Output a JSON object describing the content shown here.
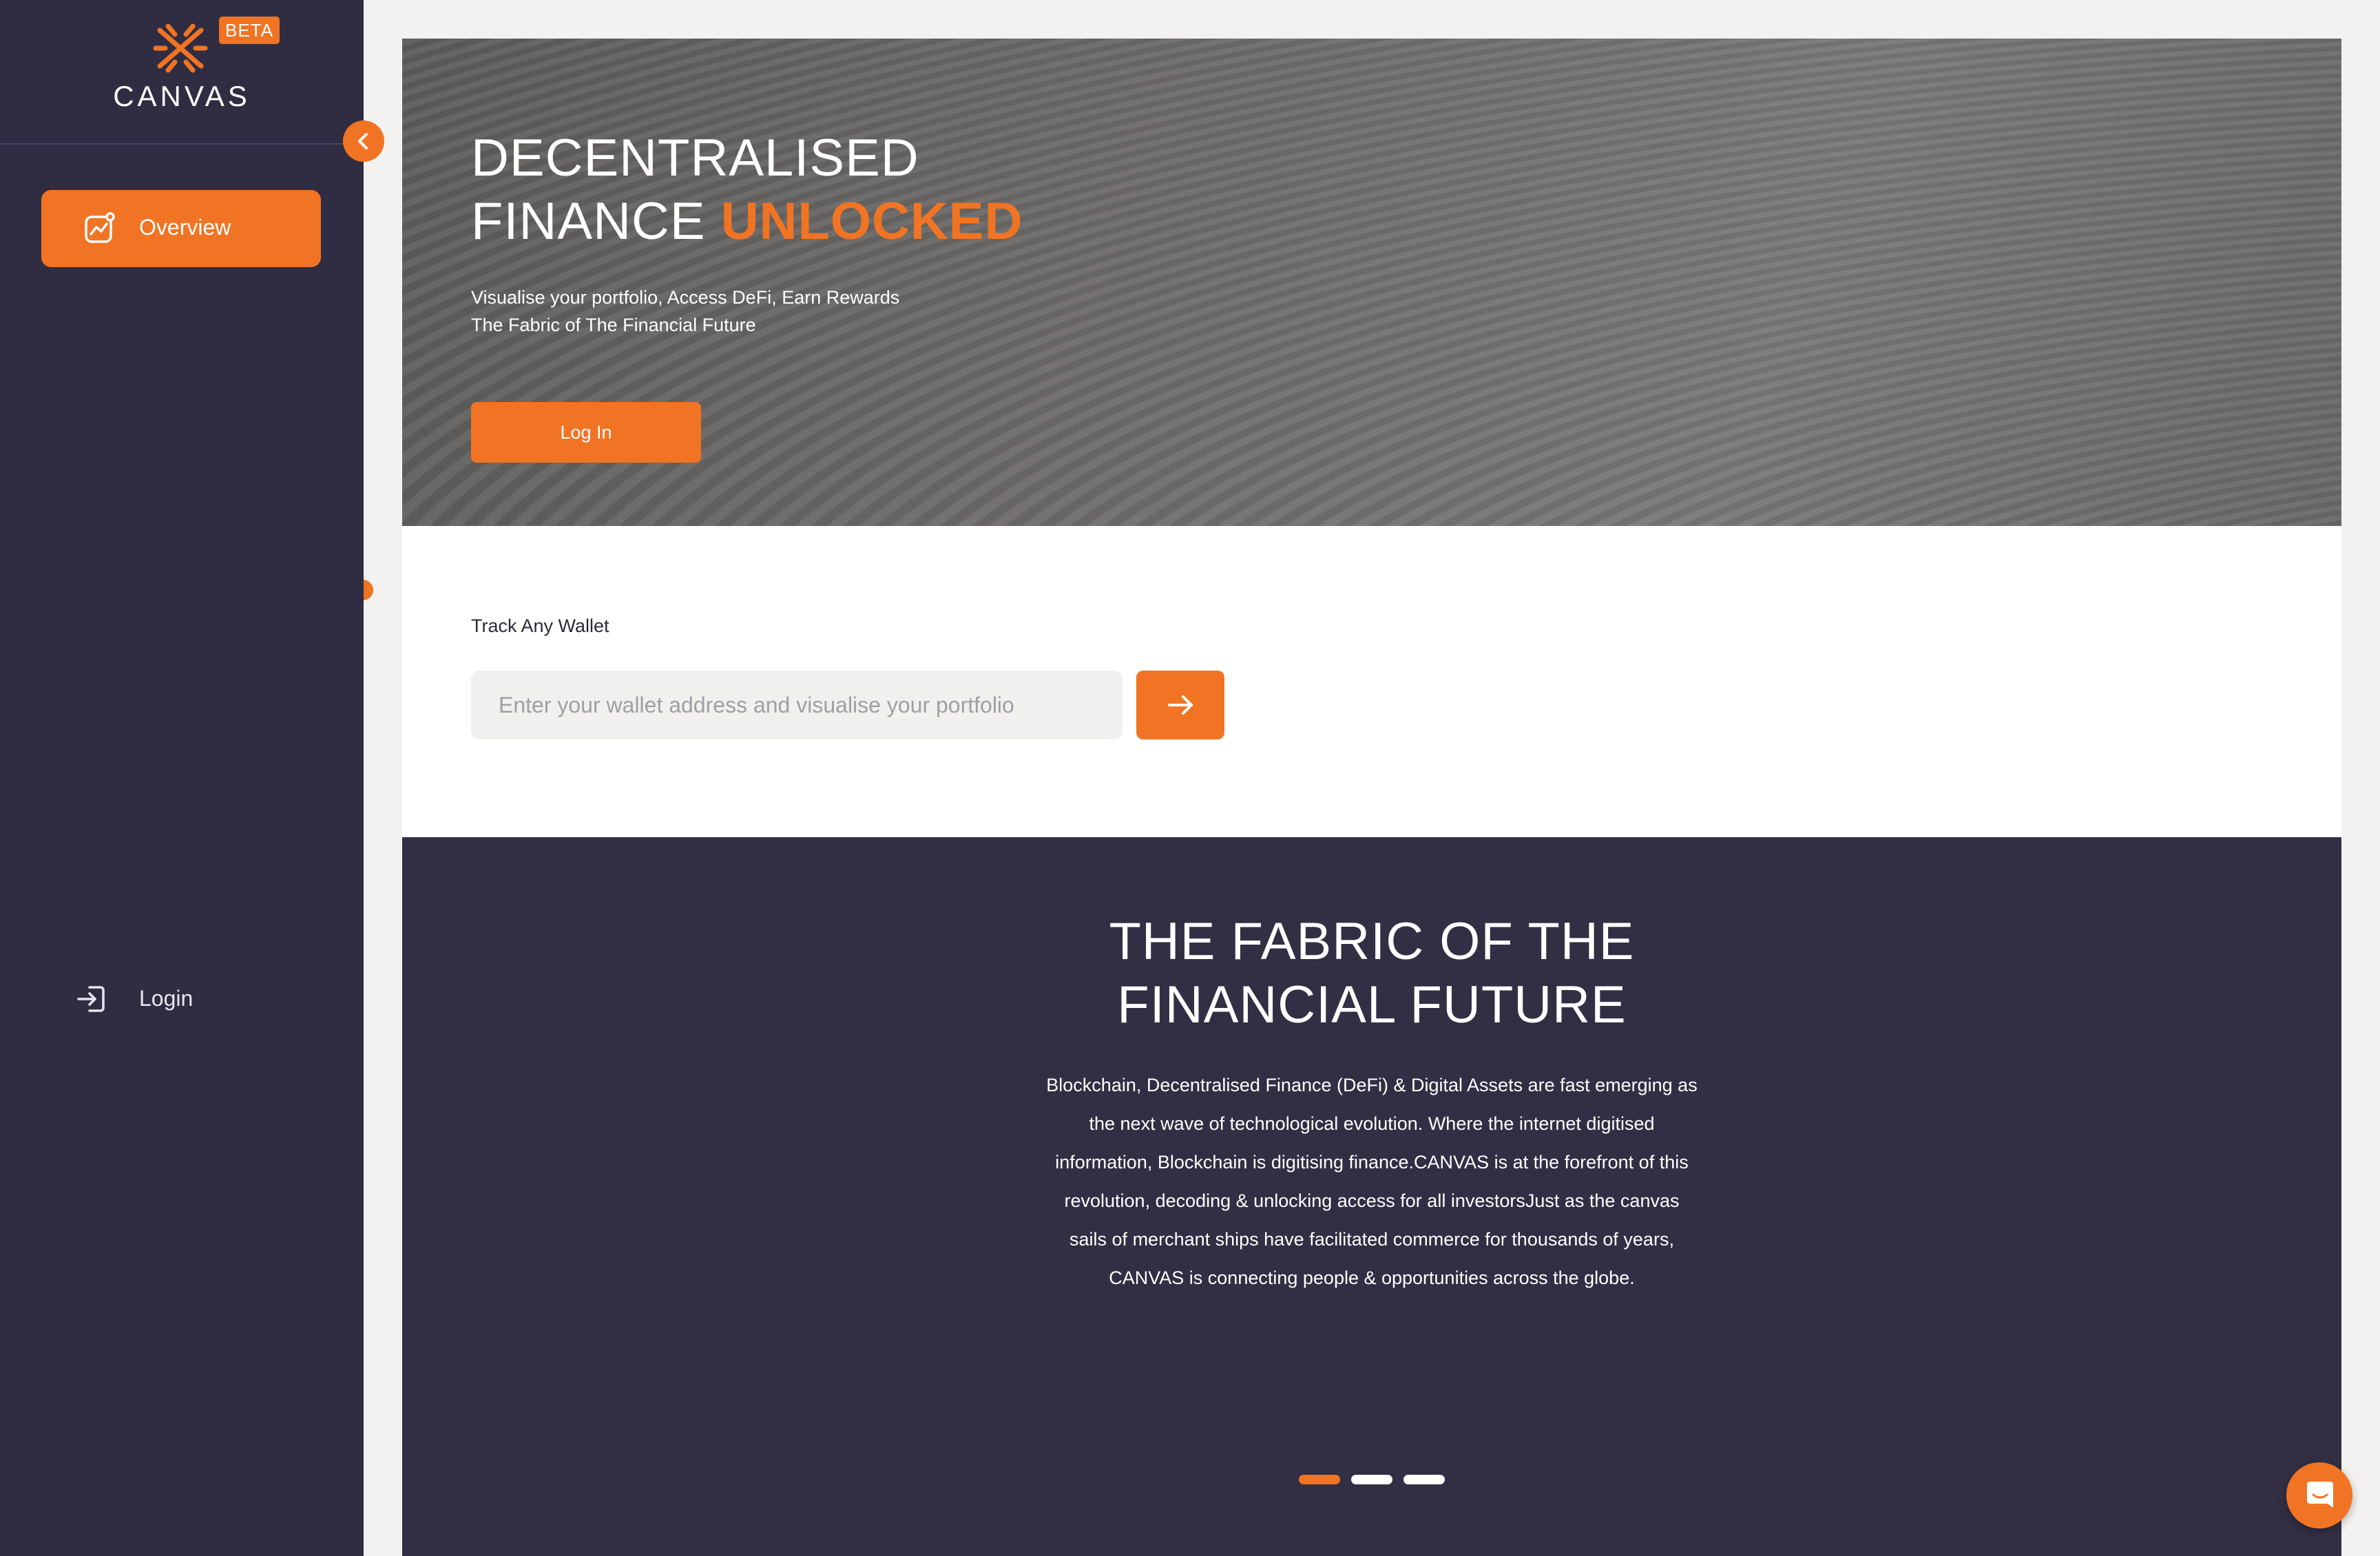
{
  "brand": {
    "name": "CANVAS",
    "badge": "BETA",
    "logo_icon": "canvas-logo-icon"
  },
  "sidebar": {
    "collapse_icon": "chevron-left-icon",
    "items": [
      {
        "label": "Overview",
        "icon": "chart-icon",
        "active": true
      },
      {
        "label": "Login",
        "icon": "login-icon",
        "active": false
      }
    ]
  },
  "hero": {
    "title_line1": "DECENTRALISED",
    "title_line2_prefix": "FINANCE ",
    "title_line2_accent": "UNLOCKED",
    "subtitle_line1": "Visualise your portfolio, Access DeFi, Earn Rewards",
    "subtitle_line2": "The Fabric of The Financial Future",
    "login_button": "Log In"
  },
  "track": {
    "label": "Track Any Wallet",
    "input_placeholder": "Enter your wallet address and visualise your portfolio",
    "input_value": "",
    "submit_icon": "arrow-right-icon"
  },
  "fabric": {
    "title_line1": "THE FABRIC OF THE",
    "title_line2": "FINANCIAL FUTURE",
    "body_lines": [
      "Blockchain, Decentralised Finance (DeFi) & Digital Assets are fast emerging as",
      "the next wave of technological evolution. Where the internet digitised",
      "information, Blockchain is digitising finance.CANVAS is at the forefront of this",
      "revolution, decoding & unlocking access for all investorsJust as the canvas",
      "sails of merchant ships have facilitated commerce for thousands of years,",
      "CANVAS is connecting people & opportunities across the globe."
    ],
    "carousel": {
      "slides": 3,
      "active_index": 0
    }
  },
  "chat": {
    "icon": "chat-icon"
  },
  "colors": {
    "accent": "#f07423",
    "sidebar": "#302d42",
    "dark_section": "#322f44",
    "page_bg": "#f3f2f0"
  }
}
